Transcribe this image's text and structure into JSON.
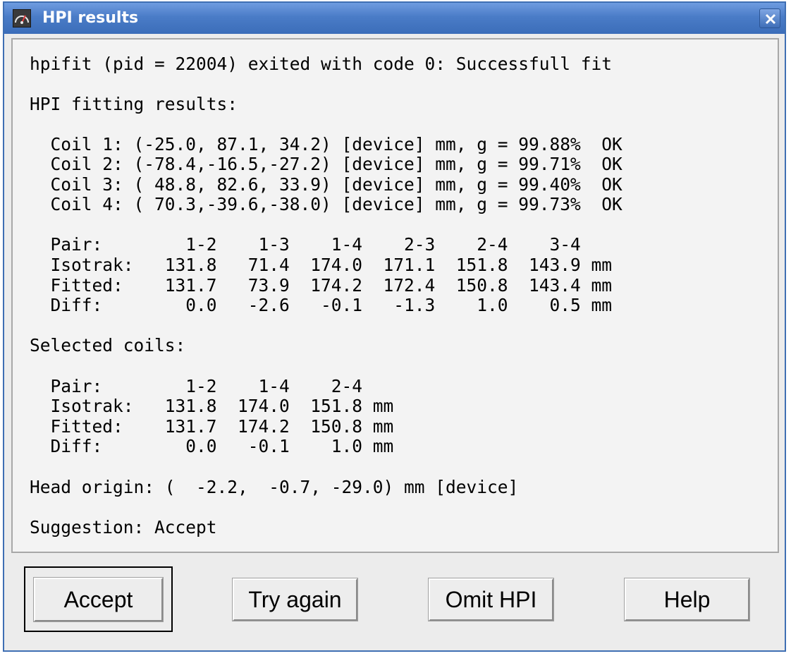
{
  "window": {
    "title": "HPI results"
  },
  "report": {
    "lines": [
      "hpifit (pid = 22004) exited with code 0: Successfull fit",
      "HPI fitting results:",
      "  Coil 1: (-25.0, 87.1, 34.2) [device] mm, g = 99.88%  OK",
      "  Coil 2: (-78.4,-16.5,-27.2) [device] mm, g = 99.71%  OK",
      "  Coil 3: ( 48.8, 82.6, 33.9) [device] mm, g = 99.40%  OK",
      "  Coil 4: ( 70.3,-39.6,-38.0) [device] mm, g = 99.73%  OK",
      "  Pair:        1-2    1-3    1-4    2-3    2-4    3-4",
      "  Isotrak:   131.8   71.4  174.0  171.1  151.8  143.9 mm",
      "  Fitted:    131.7   73.9  174.2  172.4  150.8  143.4 mm",
      "  Diff:        0.0   -2.6   -0.1   -1.3    1.0    0.5 mm",
      "Selected coils:",
      "  Pair:        1-2    1-4    2-4",
      "  Isotrak:   131.8  174.0  151.8 mm",
      "  Fitted:    131.7  174.2  150.8 mm",
      "  Diff:        0.0   -0.1    1.0 mm",
      "Head origin: (  -2.2,  -0.7, -29.0) mm [device]",
      "Suggestion: Accept"
    ]
  },
  "buttons": {
    "accept": "Accept",
    "try_again": "Try again",
    "omit_hpi": "Omit HPI",
    "help": "Help"
  },
  "icons": {
    "app": "gauge-icon",
    "close": "close-icon"
  }
}
